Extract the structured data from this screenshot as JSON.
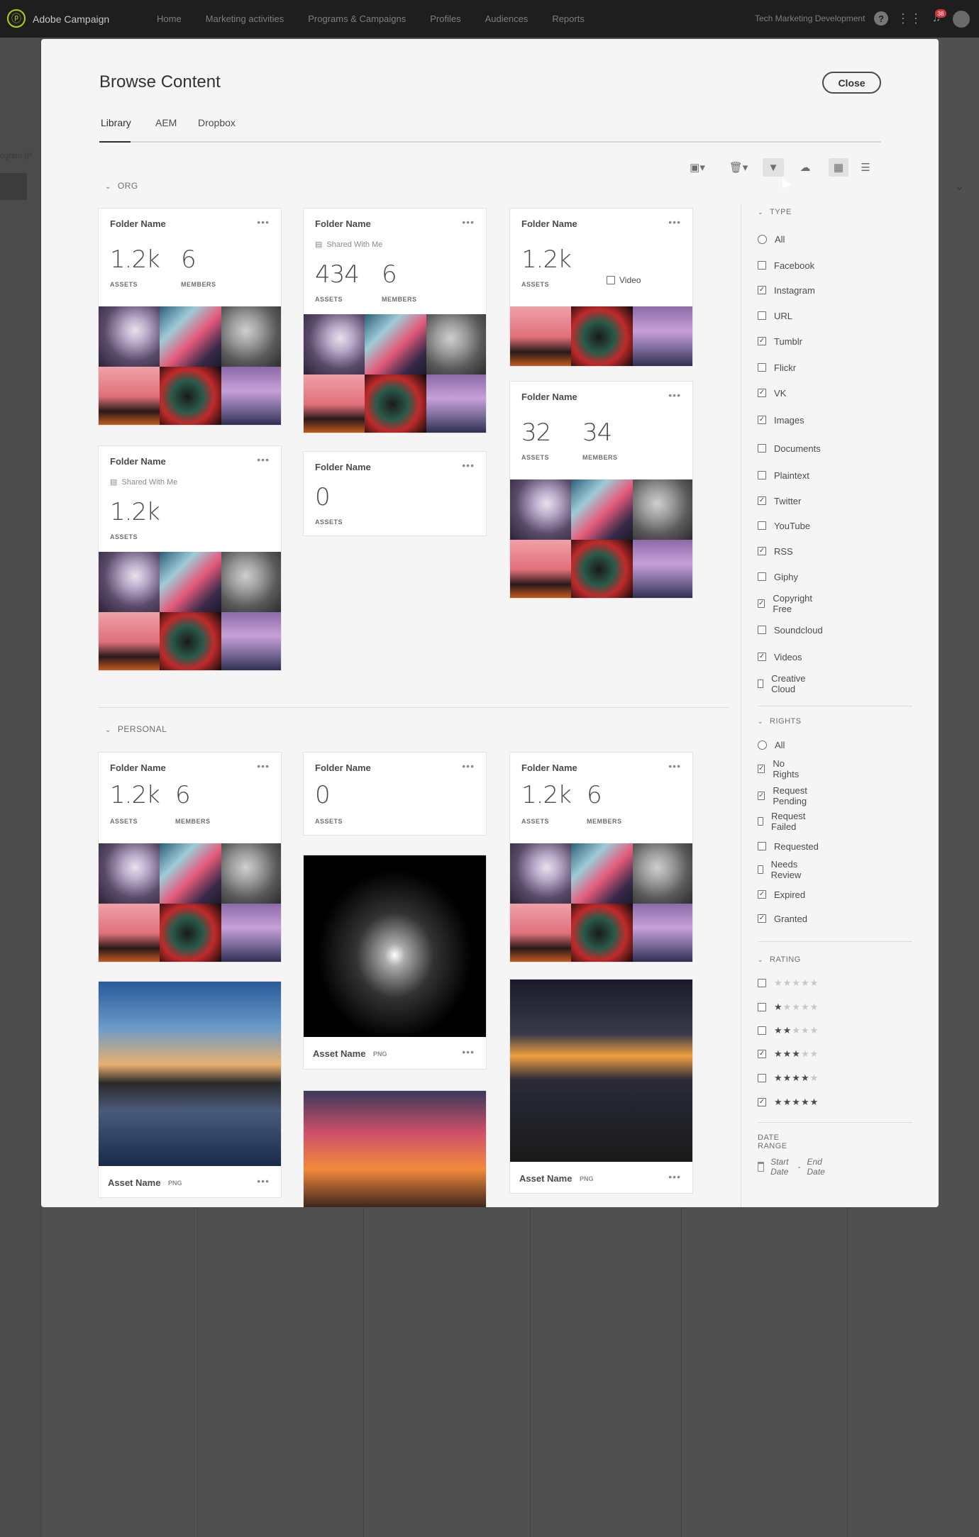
{
  "app": {
    "name": "Adobe Campaign",
    "nav": [
      "Home",
      "Marketing activities",
      "Programs & Campaigns",
      "Profiles",
      "Audiences",
      "Reports"
    ],
    "org": "Tech Marketing Development",
    "notifications": "38",
    "background_text": "ogram (P"
  },
  "modal": {
    "title": "Browse Content",
    "close_label": "Close",
    "tabs": [
      "Library",
      "AEM",
      "Dropbox"
    ],
    "active_tab": "Library"
  },
  "sections": {
    "org": "ORG",
    "personal": "PERSONAL"
  },
  "labels": {
    "assets": "ASSETS",
    "members": "MEMBERS",
    "shared": "Shared With Me",
    "video": "Video",
    "more": "•••"
  },
  "org_cards": [
    {
      "name": "Folder Name",
      "assets": "1.2k",
      "members": "6"
    },
    {
      "name": "Folder Name",
      "assets": "434",
      "members": "6",
      "shared": true
    },
    {
      "name": "Folder Name",
      "assets": "1.2k",
      "video_checkbox": true
    },
    {
      "name": "Folder Name",
      "assets": "32",
      "members": "34"
    },
    {
      "name": "Folder Name",
      "assets": "1.2k",
      "shared": true
    },
    {
      "name": "Folder Name",
      "assets": "0"
    }
  ],
  "personal_cards": [
    {
      "name": "Folder Name",
      "assets": "1.2k",
      "members": "6"
    },
    {
      "name": "Folder Name",
      "assets": "0"
    },
    {
      "name": "Folder Name",
      "assets": "1.2k",
      "members": "6"
    }
  ],
  "assets": [
    {
      "name": "Asset Name",
      "ext": "PNG"
    },
    {
      "name": "Asset Name",
      "ext": "PNG"
    },
    {
      "name": "Asset Name",
      "ext": "PNG"
    }
  ],
  "filters": {
    "type_header": "TYPE",
    "type": [
      {
        "label": "All",
        "kind": "radio"
      },
      {
        "label": "Facebook",
        "checked": false
      },
      {
        "label": "Instagram",
        "checked": true
      },
      {
        "label": "URL",
        "checked": false
      },
      {
        "label": "Tumblr",
        "checked": true
      },
      {
        "label": "Flickr",
        "checked": false
      },
      {
        "label": "VK",
        "checked": true
      },
      {
        "label": "Images",
        "checked": true
      },
      {
        "label": "Documents",
        "checked": false
      },
      {
        "label": "Plaintext",
        "checked": false
      },
      {
        "label": "Twitter",
        "checked": true
      },
      {
        "label": "YouTube",
        "checked": false
      },
      {
        "label": "RSS",
        "checked": true
      },
      {
        "label": "Giphy",
        "checked": false
      },
      {
        "label": "Copyright Free",
        "checked": true
      },
      {
        "label": "Soundcloud",
        "checked": false
      },
      {
        "label": "Videos",
        "checked": true
      },
      {
        "label": "Creative Cloud",
        "checked": false
      }
    ],
    "rights_header": "RIGHTS",
    "rights": [
      {
        "label": "All",
        "kind": "radio"
      },
      {
        "label": "No Rights",
        "checked": true
      },
      {
        "label": "Request Pending",
        "checked": true
      },
      {
        "label": "Request Failed",
        "checked": false
      },
      {
        "label": "Requested",
        "checked": false
      },
      {
        "label": "Needs Review",
        "checked": false
      },
      {
        "label": "Expired",
        "checked": true
      },
      {
        "label": "Granted",
        "checked": true
      }
    ],
    "rating_header": "RATING",
    "rating": [
      {
        "stars": 0,
        "checked": false
      },
      {
        "stars": 1,
        "checked": false
      },
      {
        "stars": 2,
        "checked": false
      },
      {
        "stars": 3,
        "checked": true
      },
      {
        "stars": 4,
        "checked": false
      },
      {
        "stars": 5,
        "checked": true
      }
    ],
    "date_header": "DATE RANGE",
    "date_start": "Start Date",
    "date_sep": "-",
    "date_end": "End Date"
  },
  "icons": {
    "folder_add": "folder-add-icon",
    "delete": "trash-icon",
    "filter": "filter-icon",
    "upload": "cloud-upload-icon",
    "grid": "grid-view-icon",
    "list": "list-view-icon"
  },
  "colors": {
    "accent": "#b5cc18",
    "badge": "#d7373f",
    "topbar": "#1e1e1e",
    "modal": "#f5f5f5"
  }
}
